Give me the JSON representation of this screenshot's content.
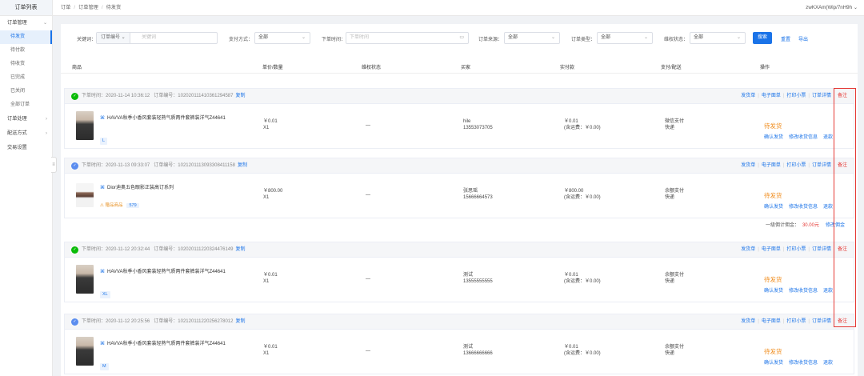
{
  "sidebar": {
    "title": "订单列表",
    "groups": [
      {
        "label": "订单管理",
        "chevron": "chevron-down-icon"
      },
      {
        "label": "订单处理",
        "chevron": "chevron-right-icon"
      },
      {
        "label": "配送方式",
        "chevron": "chevron-right-icon"
      },
      {
        "label": "交易设置",
        "chevron": ""
      }
    ],
    "items": [
      {
        "label": "待发货",
        "active": true
      },
      {
        "label": "待付款",
        "active": false
      },
      {
        "label": "待收货",
        "active": false
      },
      {
        "label": "已完成",
        "active": false
      },
      {
        "label": "已关闭",
        "active": false
      },
      {
        "label": "全部订单",
        "active": false
      }
    ],
    "collapse_icon": "≡"
  },
  "header": {
    "breadcrumbs": [
      "订单",
      "订单管理",
      "待发货"
    ],
    "separator": "/",
    "user": "zwKXAm(Wip/7nH9h"
  },
  "filters": {
    "keyword_label": "关键词：",
    "keyword_select": "订单编号",
    "keyword_placeholder": "关键词",
    "pay_label": "支付方式：",
    "pay_value": "全部",
    "time_label": "下单时间：",
    "time_placeholder": "下单时间",
    "source_label": "订单来源：",
    "source_value": "全部",
    "type_label": "订单类型：",
    "type_value": "全部",
    "rights_label": "维权状态：",
    "rights_value": "全部",
    "search_label": "搜索",
    "reset_label": "重置",
    "export_label": "导出"
  },
  "table": {
    "columns": [
      "商品",
      "单价/数量",
      "维权状态",
      "买家",
      "实付款",
      "支付/配送",
      "操作"
    ]
  },
  "row_actions": {
    "items": [
      "发货单",
      "电子面单",
      "打印小票",
      "订单详情"
    ],
    "note": "备注"
  },
  "order_actions": [
    "确认发货",
    "修改收货信息",
    "退款"
  ],
  "orders": [
    {
      "pay_icon": "wx",
      "time": "下单时间：2020-11-14 10:36:12",
      "order_no": "订单编号：102020111410361294587",
      "copy": "复制",
      "product": "HAVVA秋季小香风套装轻熟气质两件套裤装洋气Z44641",
      "sku": "L",
      "price": "￥0.01",
      "qty": "X1",
      "rights": "—",
      "buyer": "hile",
      "phone": "13553073705",
      "paid": "￥0.01",
      "freight": "(含运费：￥0.00)",
      "pay_method": "微信支付",
      "delivery": "快递",
      "status": "待发货"
    },
    {
      "pay_icon": "ap",
      "time": "下单时间：2020-11-13 09:33:07",
      "order_no": "订单编号：1021201113093308411158",
      "copy": "复制",
      "product": "Dior迪奥五色眼影正装高订系列",
      "gift": "赠品商品",
      "gift_count": "579",
      "price": "￥800.00",
      "qty": "X1",
      "rights": "—",
      "buyer": "张思瑶",
      "phone": "15666664573",
      "paid": "￥800.00",
      "freight": "(含运费：￥0.00)",
      "pay_method": "余额支付",
      "delivery": "快递",
      "status": "待发货",
      "summary_label": "一级佣计佣金：",
      "summary_value": "30.00元",
      "summary_link": "修改佣金"
    },
    {
      "pay_icon": "wx",
      "time": "下单时间：2020-11-12 20:32:44",
      "order_no": "订单编号：102020111220324476149",
      "copy": "复制",
      "product": "HAVVA秋季小香风套装轻熟气质两件套裤装洋气Z44641",
      "sku": "XL",
      "price": "￥0.01",
      "qty": "X1",
      "rights": "—",
      "buyer": "测试",
      "phone": "13555555555",
      "paid": "￥0.01",
      "freight": "(含运费：￥0.00)",
      "pay_method": "余额支付",
      "delivery": "快递",
      "status": "待发货"
    },
    {
      "pay_icon": "ap",
      "time": "下单时间：2020-11-12 20:25:56",
      "order_no": "订单编号：102120111220256278012",
      "copy": "复制",
      "product": "HAVVA秋季小香风套装轻熟气质两件套裤装洋气Z44641",
      "sku": "M",
      "price": "￥0.01",
      "qty": "X1",
      "rights": "—",
      "buyer": "测试",
      "phone": "13666666666",
      "paid": "￥0.01",
      "freight": "(含运费：￥0.00)",
      "pay_method": "余额支付",
      "delivery": "快递",
      "status": "待发货"
    }
  ],
  "colors": {
    "accent": "#1a73e8",
    "status": "#f08c1c",
    "note": "#e53935",
    "wechat": "#09bb07"
  }
}
